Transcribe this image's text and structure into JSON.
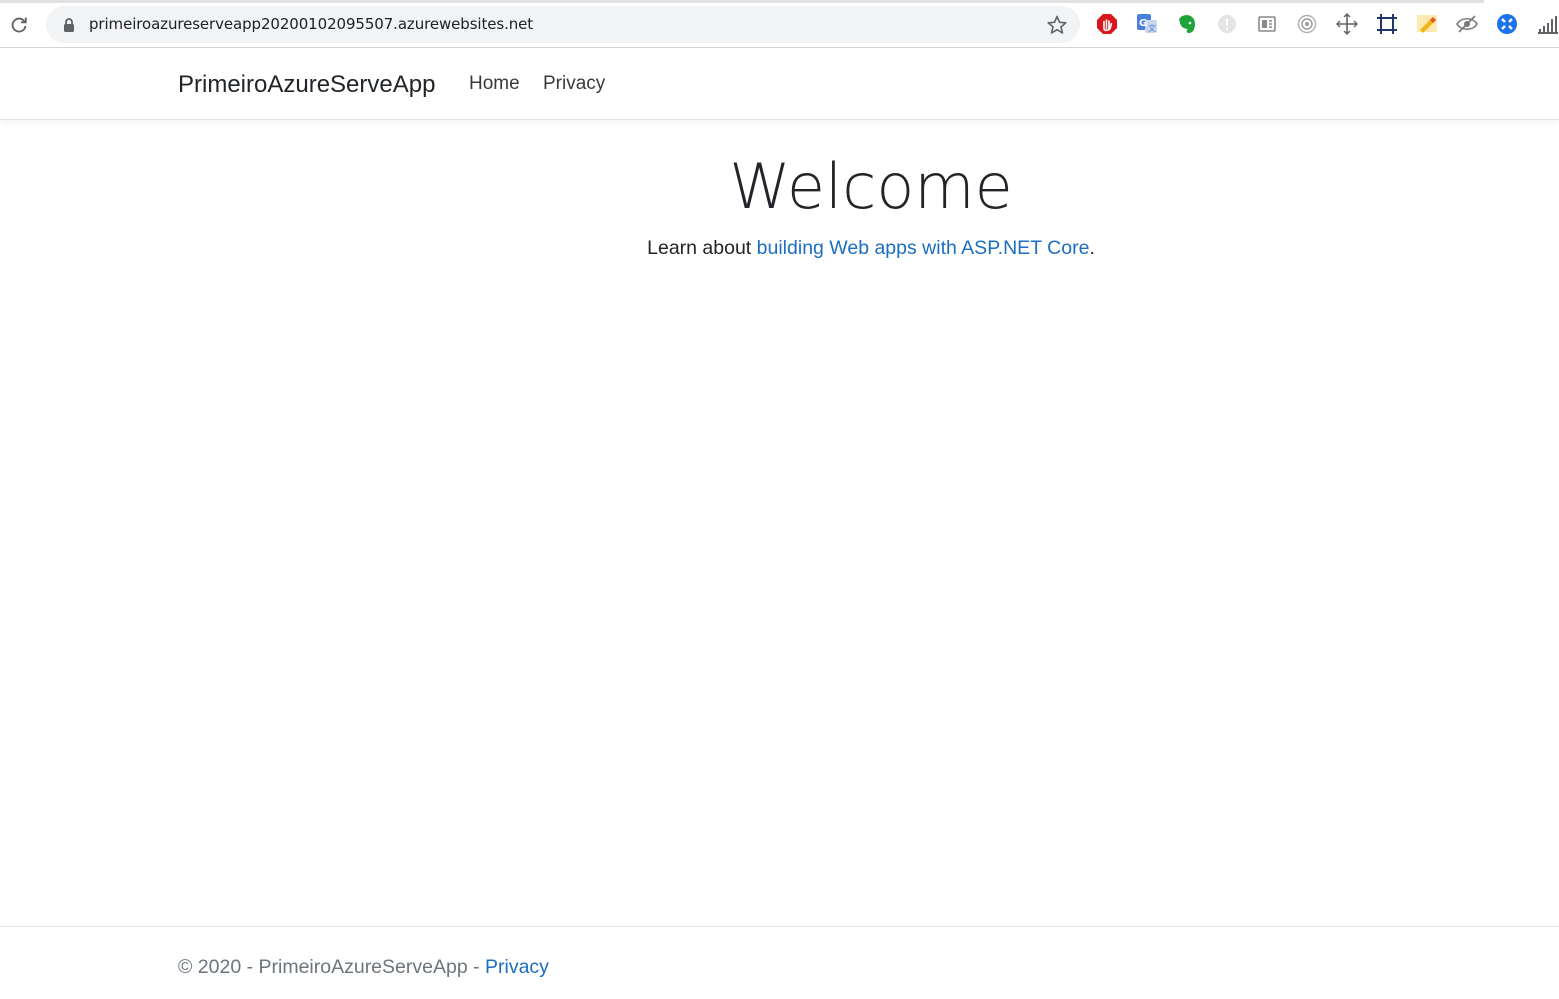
{
  "browser": {
    "url": "primeiroazureserveapp20200102095507.azurewebsites.net",
    "extensions": [
      {
        "name": "adblock-icon",
        "color": "#d9161c"
      },
      {
        "name": "google-translate-icon",
        "color": "#4a7fe0"
      },
      {
        "name": "evernote-icon",
        "color": "#1fa43a"
      },
      {
        "name": "grey-circle-icon",
        "color": "#d9d9d9"
      },
      {
        "name": "reader-icon",
        "color": "#8a8a8a"
      },
      {
        "name": "target-icon",
        "color": "#9a9a9a"
      },
      {
        "name": "move-cross-icon",
        "color": "#5f6368"
      },
      {
        "name": "crop-frame-icon",
        "color": "#1f3a66"
      },
      {
        "name": "highlighter-icon",
        "color": "#f3b218"
      },
      {
        "name": "eye-slash-icon",
        "color": "#7a7a7a"
      },
      {
        "name": "blue-circle-icon",
        "color": "#1a73e8"
      },
      {
        "name": "signal-bars-icon",
        "color": "#5f6368"
      }
    ]
  },
  "navbar": {
    "brand": "PrimeiroAzureServeApp",
    "links": [
      "Home",
      "Privacy"
    ]
  },
  "main": {
    "title": "Welcome",
    "lead_prefix": "Learn about ",
    "lead_link": "building Web apps with ASP.NET Core",
    "lead_suffix": "."
  },
  "footer": {
    "text": "© 2020 - PrimeiroAzureServeApp - ",
    "link": "Privacy"
  },
  "colors": {
    "link": "#1b6ec2",
    "text": "#212529",
    "muted": "#6c757d"
  }
}
